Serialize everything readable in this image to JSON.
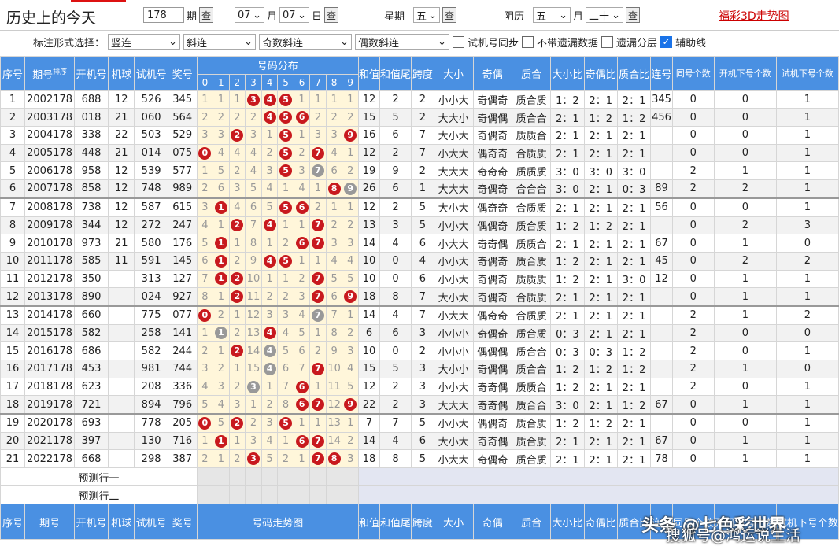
{
  "header": {
    "title": "历史上的今天",
    "date_input": "178",
    "period_label": "期",
    "query_label": "查",
    "month_value": "07",
    "month_label": "月",
    "day_value": "07",
    "day_label": "日",
    "weekday_label": "星期",
    "weekday_value": "五",
    "lunar_label": "阴历",
    "lunar_month": "五",
    "lunar_month_label": "月",
    "lunar_day": "二十",
    "link_3d": "福彩3D走势图"
  },
  "options": {
    "mark_label": "标注形式选择：",
    "vert": "竖连",
    "diag": "斜连",
    "odd_diag": "奇数斜连",
    "even_diag": "偶数斜连",
    "cb_sync": "试机号同步",
    "cb_nomiss": "不带遗漏数据",
    "cb_layer": "遗漏分层",
    "cb_aux": "辅助线"
  },
  "columns": {
    "idx": "序号",
    "period": "期号",
    "sort": "排序",
    "open": "开机号",
    "machine": "机球",
    "test": "试机号",
    "prize": "奖号",
    "dist": "号码分布",
    "trend": "号码走势图",
    "sum": "和值",
    "sumtail": "和值尾",
    "span": "跨度",
    "size": "大小",
    "oddeven": "奇偶",
    "prime": "质合",
    "size_ratio": "大小比",
    "oe_ratio": "奇偶比",
    "prime_ratio": "质合比",
    "consec": "连号",
    "same": "同号个数",
    "next_open": "开机下号个数",
    "next_test": "试机下号个数",
    "digits": [
      "0",
      "1",
      "2",
      "3",
      "4",
      "5",
      "6",
      "7",
      "8",
      "9"
    ]
  },
  "rows": [
    {
      "i": "1",
      "p": "2002178",
      "o": "688",
      "m": "12",
      "t": "526",
      "z": "345",
      "d": [
        [
          "1",
          0
        ],
        [
          "1",
          0
        ],
        [
          "1",
          0
        ],
        [
          "3",
          1
        ],
        [
          "4",
          1
        ],
        [
          "5",
          1
        ],
        [
          "1",
          0
        ],
        [
          "1",
          0
        ],
        [
          "1",
          0
        ],
        [
          "1",
          0
        ]
      ],
      "s": "12",
      "st": "2",
      "sp": "2",
      "dx": "小小大",
      "jo": "奇偶奇",
      "zh": "质合质",
      "r1": "1：2",
      "r2": "2：1",
      "r3": "2：1",
      "lh": "345",
      "th": "0",
      "kn": "0",
      "sn": "1"
    },
    {
      "i": "2",
      "p": "2003178",
      "o": "018",
      "m": "21",
      "t": "060",
      "z": "564",
      "d": [
        [
          "2",
          0
        ],
        [
          "2",
          0
        ],
        [
          "2",
          0
        ],
        [
          "2",
          0
        ],
        [
          "4",
          1
        ],
        [
          "5",
          1
        ],
        [
          "6",
          1
        ],
        [
          "2",
          0
        ],
        [
          "2",
          0
        ],
        [
          "2",
          0
        ]
      ],
      "s": "15",
      "st": "5",
      "sp": "2",
      "dx": "大大小",
      "jo": "奇偶偶",
      "zh": "质合合",
      "r1": "2：1",
      "r2": "1：2",
      "r3": "1：2",
      "lh": "456",
      "th": "0",
      "kn": "0",
      "sn": "1"
    },
    {
      "i": "3",
      "p": "2004178",
      "o": "338",
      "m": "22",
      "t": "503",
      "z": "529",
      "d": [
        [
          "3",
          0
        ],
        [
          "3",
          0
        ],
        [
          "2",
          1
        ],
        [
          "3",
          0
        ],
        [
          "1",
          0
        ],
        [
          "5",
          1
        ],
        [
          "1",
          0
        ],
        [
          "3",
          0
        ],
        [
          "3",
          0
        ],
        [
          "9",
          1
        ]
      ],
      "s": "16",
      "st": "6",
      "sp": "7",
      "dx": "大小大",
      "jo": "奇偶奇",
      "zh": "质质合",
      "r1": "2：1",
      "r2": "2：1",
      "r3": "2：1",
      "lh": "",
      "th": "0",
      "kn": "0",
      "sn": "1"
    },
    {
      "i": "4",
      "p": "2005178",
      "o": "448",
      "m": "21",
      "t": "014",
      "z": "075",
      "d": [
        [
          "0",
          1
        ],
        [
          "4",
          0
        ],
        [
          "4",
          0
        ],
        [
          "4",
          0
        ],
        [
          "2",
          0
        ],
        [
          "5",
          1
        ],
        [
          "2",
          0
        ],
        [
          "7",
          1
        ],
        [
          "4",
          0
        ],
        [
          "1",
          0
        ]
      ],
      "s": "12",
      "st": "2",
      "sp": "7",
      "dx": "小大大",
      "jo": "偶奇奇",
      "zh": "合质质",
      "r1": "2：1",
      "r2": "2：1",
      "r3": "2：1",
      "lh": "",
      "th": "0",
      "kn": "0",
      "sn": "1"
    },
    {
      "i": "5",
      "p": "2006178",
      "o": "958",
      "m": "12",
      "t": "539",
      "z": "577",
      "d": [
        [
          "1",
          0
        ],
        [
          "5",
          0
        ],
        [
          "2",
          0
        ],
        [
          "4",
          0
        ],
        [
          "3",
          0
        ],
        [
          "5",
          1
        ],
        [
          "3",
          0
        ],
        [
          "7",
          2
        ],
        [
          "6",
          0
        ],
        [
          "2",
          0
        ]
      ],
      "s": "19",
      "st": "9",
      "sp": "2",
      "dx": "大大大",
      "jo": "奇奇奇",
      "zh": "质质质",
      "r1": "3：0",
      "r2": "3：0",
      "r3": "3：0",
      "lh": "",
      "th": "2",
      "kn": "1",
      "sn": "1"
    },
    {
      "i": "6",
      "p": "2007178",
      "o": "858",
      "m": "12",
      "t": "748",
      "z": "989",
      "d": [
        [
          "2",
          0
        ],
        [
          "6",
          0
        ],
        [
          "3",
          0
        ],
        [
          "5",
          0
        ],
        [
          "4",
          0
        ],
        [
          "1",
          0
        ],
        [
          "4",
          0
        ],
        [
          "1",
          0
        ],
        [
          "8",
          1
        ],
        [
          "9",
          2
        ]
      ],
      "s": "26",
      "st": "6",
      "sp": "1",
      "dx": "大大大",
      "jo": "奇偶奇",
      "zh": "合合合",
      "r1": "3：0",
      "r2": "2：1",
      "r3": "0：3",
      "lh": "89",
      "th": "2",
      "kn": "2",
      "sn": "1"
    },
    {
      "i": "7",
      "p": "2008178",
      "o": "738",
      "m": "12",
      "t": "587",
      "z": "615",
      "d": [
        [
          "3",
          0
        ],
        [
          "1",
          1
        ],
        [
          "4",
          0
        ],
        [
          "6",
          0
        ],
        [
          "5",
          0
        ],
        [
          "5",
          1
        ],
        [
          "6",
          1
        ],
        [
          "2",
          0
        ],
        [
          "1",
          0
        ],
        [
          "1",
          0
        ]
      ],
      "s": "12",
      "st": "2",
      "sp": "5",
      "dx": "大小大",
      "jo": "偶奇奇",
      "zh": "合质质",
      "r1": "2：1",
      "r2": "2：1",
      "r3": "2：1",
      "lh": "56",
      "th": "0",
      "kn": "0",
      "sn": "1",
      "sep": 1
    },
    {
      "i": "8",
      "p": "2009178",
      "o": "344",
      "m": "12",
      "t": "272",
      "z": "247",
      "d": [
        [
          "4",
          0
        ],
        [
          "1",
          0
        ],
        [
          "2",
          1
        ],
        [
          "7",
          0
        ],
        [
          "4",
          1
        ],
        [
          "1",
          0
        ],
        [
          "1",
          0
        ],
        [
          "7",
          1
        ],
        [
          "2",
          0
        ],
        [
          "2",
          0
        ]
      ],
      "s": "13",
      "st": "3",
      "sp": "5",
      "dx": "小小大",
      "jo": "偶偶奇",
      "zh": "质合质",
      "r1": "1：2",
      "r2": "1：2",
      "r3": "2：1",
      "lh": "",
      "th": "0",
      "kn": "2",
      "sn": "3"
    },
    {
      "i": "9",
      "p": "2010178",
      "o": "973",
      "m": "21",
      "t": "580",
      "z": "176",
      "d": [
        [
          "5",
          0
        ],
        [
          "1",
          1
        ],
        [
          "1",
          0
        ],
        [
          "8",
          0
        ],
        [
          "1",
          0
        ],
        [
          "2",
          0
        ],
        [
          "6",
          1
        ],
        [
          "7",
          1
        ],
        [
          "3",
          0
        ],
        [
          "3",
          0
        ]
      ],
      "s": "14",
      "st": "4",
      "sp": "6",
      "dx": "小大大",
      "jo": "奇奇偶",
      "zh": "质质合",
      "r1": "2：1",
      "r2": "2：1",
      "r3": "2：1",
      "lh": "67",
      "th": "0",
      "kn": "1",
      "sn": "0"
    },
    {
      "i": "10",
      "p": "2011178",
      "o": "585",
      "m": "11",
      "t": "591",
      "z": "145",
      "d": [
        [
          "6",
          0
        ],
        [
          "1",
          1
        ],
        [
          "2",
          0
        ],
        [
          "9",
          0
        ],
        [
          "4",
          1
        ],
        [
          "5",
          1
        ],
        [
          "1",
          0
        ],
        [
          "1",
          0
        ],
        [
          "4",
          0
        ],
        [
          "4",
          0
        ]
      ],
      "s": "10",
      "st": "0",
      "sp": "4",
      "dx": "小小大",
      "jo": "奇偶奇",
      "zh": "质合质",
      "r1": "1：2",
      "r2": "2：1",
      "r3": "2：1",
      "lh": "45",
      "th": "0",
      "kn": "2",
      "sn": "2"
    },
    {
      "i": "11",
      "p": "2012178",
      "o": "350",
      "m": "",
      "t": "313",
      "z": "127",
      "d": [
        [
          "7",
          0
        ],
        [
          "1",
          1
        ],
        [
          "2",
          1
        ],
        [
          "10",
          0
        ],
        [
          "1",
          0
        ],
        [
          "1",
          0
        ],
        [
          "2",
          0
        ],
        [
          "7",
          1
        ],
        [
          "5",
          0
        ],
        [
          "5",
          0
        ]
      ],
      "s": "10",
      "st": "0",
      "sp": "6",
      "dx": "小小大",
      "jo": "奇偶奇",
      "zh": "质质质",
      "r1": "1：2",
      "r2": "2：1",
      "r3": "3：0",
      "lh": "12",
      "th": "0",
      "kn": "1",
      "sn": "1"
    },
    {
      "i": "12",
      "p": "2013178",
      "o": "890",
      "m": "",
      "t": "024",
      "z": "927",
      "d": [
        [
          "8",
          0
        ],
        [
          "1",
          0
        ],
        [
          "2",
          1
        ],
        [
          "11",
          0
        ],
        [
          "2",
          0
        ],
        [
          "2",
          0
        ],
        [
          "3",
          0
        ],
        [
          "7",
          1
        ],
        [
          "6",
          0
        ],
        [
          "9",
          1
        ]
      ],
      "s": "18",
      "st": "8",
      "sp": "7",
      "dx": "大小大",
      "jo": "奇偶奇",
      "zh": "合质质",
      "r1": "2：1",
      "r2": "2：1",
      "r3": "2：1",
      "lh": "",
      "th": "0",
      "kn": "1",
      "sn": "1"
    },
    {
      "i": "13",
      "p": "2014178",
      "o": "660",
      "m": "",
      "t": "775",
      "z": "077",
      "d": [
        [
          "0",
          1
        ],
        [
          "2",
          0
        ],
        [
          "1",
          0
        ],
        [
          "12",
          0
        ],
        [
          "3",
          0
        ],
        [
          "3",
          0
        ],
        [
          "4",
          0
        ],
        [
          "7",
          2
        ],
        [
          "7",
          0
        ],
        [
          "1",
          0
        ]
      ],
      "s": "14",
      "st": "4",
      "sp": "7",
      "dx": "小大大",
      "jo": "偶奇奇",
      "zh": "合质质",
      "r1": "2：1",
      "r2": "2：1",
      "r3": "2：1",
      "lh": "",
      "th": "2",
      "kn": "1",
      "sn": "2",
      "sep": 1
    },
    {
      "i": "14",
      "p": "2015178",
      "o": "582",
      "m": "",
      "t": "258",
      "z": "141",
      "d": [
        [
          "1",
          0
        ],
        [
          "1",
          2
        ],
        [
          "2",
          0
        ],
        [
          "13",
          0
        ],
        [
          "4",
          1
        ],
        [
          "4",
          0
        ],
        [
          "5",
          0
        ],
        [
          "1",
          0
        ],
        [
          "8",
          0
        ],
        [
          "2",
          0
        ]
      ],
      "s": "6",
      "st": "6",
      "sp": "3",
      "dx": "小小小",
      "jo": "奇偶奇",
      "zh": "质合质",
      "r1": "0：3",
      "r2": "2：1",
      "r3": "2：1",
      "lh": "",
      "th": "2",
      "kn": "0",
      "sn": "0"
    },
    {
      "i": "15",
      "p": "2016178",
      "o": "686",
      "m": "",
      "t": "582",
      "z": "244",
      "d": [
        [
          "2",
          0
        ],
        [
          "1",
          0
        ],
        [
          "2",
          1
        ],
        [
          "14",
          0
        ],
        [
          "4",
          2
        ],
        [
          "5",
          0
        ],
        [
          "6",
          0
        ],
        [
          "2",
          0
        ],
        [
          "9",
          0
        ],
        [
          "3",
          0
        ]
      ],
      "s": "10",
      "st": "0",
      "sp": "2",
      "dx": "小小小",
      "jo": "偶偶偶",
      "zh": "质合合",
      "r1": "0：3",
      "r2": "0：3",
      "r3": "1：2",
      "lh": "",
      "th": "2",
      "kn": "0",
      "sn": "1"
    },
    {
      "i": "16",
      "p": "2017178",
      "o": "453",
      "m": "",
      "t": "981",
      "z": "744",
      "d": [
        [
          "3",
          0
        ],
        [
          "2",
          0
        ],
        [
          "1",
          0
        ],
        [
          "15",
          0
        ],
        [
          "4",
          2
        ],
        [
          "6",
          0
        ],
        [
          "7",
          0
        ],
        [
          "7",
          1
        ],
        [
          "10",
          0
        ],
        [
          "4",
          0
        ]
      ],
      "s": "15",
      "st": "5",
      "sp": "3",
      "dx": "大小小",
      "jo": "奇偶偶",
      "zh": "质合合",
      "r1": "1：2",
      "r2": "1：2",
      "r3": "1：2",
      "lh": "",
      "th": "2",
      "kn": "1",
      "sn": "0"
    },
    {
      "i": "17",
      "p": "2018178",
      "o": "623",
      "m": "",
      "t": "208",
      "z": "336",
      "d": [
        [
          "4",
          0
        ],
        [
          "3",
          0
        ],
        [
          "2",
          0
        ],
        [
          "3",
          2
        ],
        [
          "1",
          0
        ],
        [
          "7",
          0
        ],
        [
          "6",
          1
        ],
        [
          "1",
          0
        ],
        [
          "11",
          0
        ],
        [
          "5",
          0
        ]
      ],
      "s": "12",
      "st": "2",
      "sp": "3",
      "dx": "小小大",
      "jo": "奇奇偶",
      "zh": "质质合",
      "r1": "1：2",
      "r2": "2：1",
      "r3": "2：1",
      "lh": "",
      "th": "2",
      "kn": "0",
      "sn": "1"
    },
    {
      "i": "18",
      "p": "2019178",
      "o": "721",
      "m": "",
      "t": "894",
      "z": "796",
      "d": [
        [
          "5",
          0
        ],
        [
          "4",
          0
        ],
        [
          "3",
          0
        ],
        [
          "1",
          0
        ],
        [
          "2",
          0
        ],
        [
          "8",
          0
        ],
        [
          "6",
          1
        ],
        [
          "7",
          1
        ],
        [
          "12",
          0
        ],
        [
          "9",
          1
        ]
      ],
      "s": "22",
      "st": "2",
      "sp": "3",
      "dx": "大大大",
      "jo": "奇奇偶",
      "zh": "质合合",
      "r1": "3：0",
      "r2": "2：1",
      "r3": "1：2",
      "lh": "67",
      "th": "0",
      "kn": "1",
      "sn": "1"
    },
    {
      "i": "19",
      "p": "2020178",
      "o": "693",
      "m": "",
      "t": "778",
      "z": "205",
      "d": [
        [
          "0",
          1
        ],
        [
          "5",
          0
        ],
        [
          "2",
          1
        ],
        [
          "2",
          0
        ],
        [
          "3",
          0
        ],
        [
          "5",
          1
        ],
        [
          "1",
          0
        ],
        [
          "1",
          0
        ],
        [
          "13",
          0
        ],
        [
          "1",
          0
        ]
      ],
      "s": "7",
      "st": "7",
      "sp": "5",
      "dx": "小小大",
      "jo": "偶偶奇",
      "zh": "质合质",
      "r1": "1：2",
      "r2": "1：2",
      "r3": "2：1",
      "lh": "",
      "th": "0",
      "kn": "0",
      "sn": "1",
      "sep": 1
    },
    {
      "i": "20",
      "p": "2021178",
      "o": "397",
      "m": "",
      "t": "130",
      "z": "716",
      "d": [
        [
          "1",
          0
        ],
        [
          "1",
          1
        ],
        [
          "1",
          0
        ],
        [
          "3",
          0
        ],
        [
          "4",
          0
        ],
        [
          "1",
          0
        ],
        [
          "6",
          1
        ],
        [
          "7",
          1
        ],
        [
          "14",
          0
        ],
        [
          "2",
          0
        ]
      ],
      "s": "14",
      "st": "4",
      "sp": "6",
      "dx": "大小大",
      "jo": "奇奇偶",
      "zh": "质合质",
      "r1": "2：1",
      "r2": "2：1",
      "r3": "2：1",
      "lh": "67",
      "th": "0",
      "kn": "1",
      "sn": "1"
    },
    {
      "i": "21",
      "p": "2022178",
      "o": "668",
      "m": "",
      "t": "298",
      "z": "387",
      "d": [
        [
          "2",
          0
        ],
        [
          "1",
          0
        ],
        [
          "2",
          0
        ],
        [
          "3",
          1
        ],
        [
          "5",
          0
        ],
        [
          "2",
          0
        ],
        [
          "1",
          0
        ],
        [
          "7",
          1
        ],
        [
          "8",
          1
        ],
        [
          "3",
          0
        ]
      ],
      "s": "18",
      "st": "8",
      "sp": "5",
      "dx": "小大大",
      "jo": "奇偶奇",
      "zh": "质合质",
      "r1": "2：1",
      "r2": "2：1",
      "r3": "2：1",
      "lh": "78",
      "th": "0",
      "kn": "1",
      "sn": "1"
    }
  ],
  "predict": {
    "row1": "预测行一",
    "row2": "预测行二"
  },
  "watermark": {
    "line1": "头条 @七色彩世界",
    "line2": "搜狐号@鸿运说生活"
  },
  "colors": {
    "header_blue": "#4a90e2",
    "ball_red": "#c8191e",
    "zone_bg": "#fff6da"
  }
}
